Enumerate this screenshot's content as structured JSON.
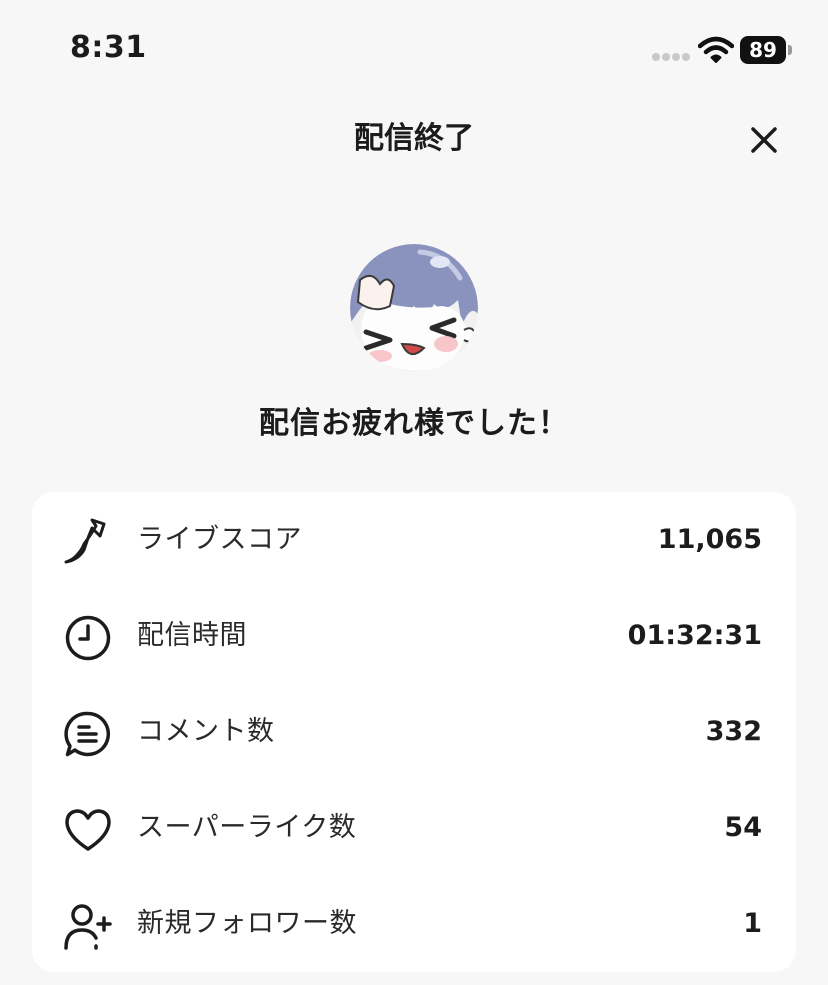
{
  "status_bar": {
    "time": "8:31",
    "battery_level": "89"
  },
  "header": {
    "title": "配信終了",
    "close_icon": "close-icon"
  },
  "message": "配信お疲れ様でした！",
  "stats": [
    {
      "icon": "live-score-icon",
      "label": "ライブスコア",
      "value": "11,065"
    },
    {
      "icon": "clock-icon",
      "label": "配信時間",
      "value": "01:32:31"
    },
    {
      "icon": "comment-icon",
      "label": "コメント数",
      "value": "332"
    },
    {
      "icon": "heart-icon",
      "label": "スーパーライク数",
      "value": "54"
    },
    {
      "icon": "add-user-icon",
      "label": "新規フォロワー数",
      "value": "1"
    }
  ]
}
